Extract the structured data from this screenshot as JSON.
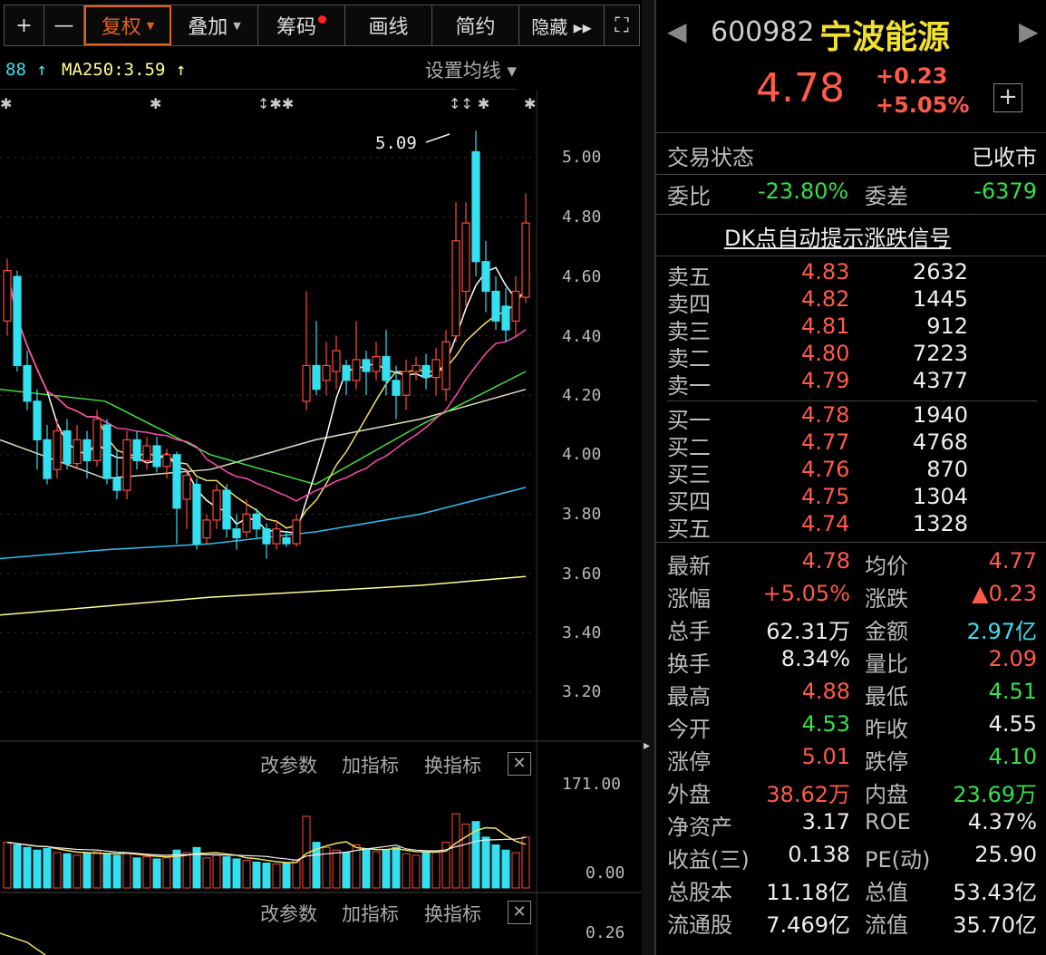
{
  "toolbar": {
    "plus": "+",
    "minus": "—",
    "fuquan": "复权",
    "diejia": "叠加",
    "chouma": "筹码",
    "huaxian": "画线",
    "jianyue": "简约",
    "yincang": "隐藏 ▸▸",
    "fullscreen": "⛶"
  },
  "legend": {
    "ma_prev": "88 ↑",
    "ma250": "MA250:3.59 ↑",
    "set_ma": "设置均线 ▾"
  },
  "peak_label": "5.09",
  "price_axis": [
    "5.00",
    "4.80",
    "4.60",
    "4.40",
    "4.20",
    "4.00",
    "3.80",
    "3.60",
    "3.40",
    "3.20"
  ],
  "volume_axis": [
    "171.00",
    "0.00"
  ],
  "indicator_axis": "0.26",
  "pane_buttons": {
    "params": "改参数",
    "add": "加指标",
    "swap": "换指标",
    "close": "✕"
  },
  "colors": {
    "up": "#ff4a3a",
    "down": "#33e0f0",
    "ma5": "#ffffff",
    "ma10": "#f0e060",
    "ma20": "#ff4ab0",
    "ma30": "#40e040",
    "ma60": "#e0e0c0",
    "ma120": "#30c0f0",
    "ma250": "#ffff90"
  },
  "chart_data": {
    "type": "candlestick",
    "ohlc": [
      [
        4.45,
        4.62,
        4.66,
        4.4
      ],
      [
        4.6,
        4.3,
        4.62,
        4.28
      ],
      [
        4.3,
        4.18,
        4.35,
        4.15
      ],
      [
        4.18,
        4.05,
        4.22,
        3.95
      ],
      [
        4.05,
        3.92,
        4.1,
        3.9
      ],
      [
        3.95,
        4.08,
        4.12,
        3.92
      ],
      [
        4.08,
        3.97,
        4.12,
        3.95
      ],
      [
        3.97,
        4.05,
        4.1,
        3.95
      ],
      [
        4.05,
        3.98,
        4.08,
        3.92
      ],
      [
        3.98,
        4.12,
        4.15,
        3.96
      ],
      [
        4.1,
        3.92,
        4.12,
        3.9
      ],
      [
        3.92,
        3.88,
        4.02,
        3.85
      ],
      [
        3.88,
        4.05,
        4.08,
        3.85
      ],
      [
        4.05,
        3.98,
        4.08,
        3.95
      ],
      [
        3.98,
        4.03,
        4.06,
        3.95
      ],
      [
        4.03,
        3.96,
        4.06,
        3.94
      ],
      [
        3.96,
        4.0,
        4.02,
        3.92
      ],
      [
        4.0,
        3.82,
        4.01,
        3.7
      ],
      [
        3.85,
        3.93,
        3.95,
        3.75
      ],
      [
        3.9,
        3.7,
        3.92,
        3.68
      ],
      [
        3.72,
        3.78,
        3.8,
        3.7
      ],
      [
        3.78,
        3.88,
        3.9,
        3.75
      ],
      [
        3.88,
        3.75,
        3.9,
        3.72
      ],
      [
        3.75,
        3.72,
        3.8,
        3.68
      ],
      [
        3.74,
        3.8,
        3.85,
        3.72
      ],
      [
        3.8,
        3.75,
        3.82,
        3.72
      ],
      [
        3.75,
        3.7,
        3.77,
        3.65
      ],
      [
        3.7,
        3.75,
        3.78,
        3.68
      ],
      [
        3.72,
        3.7,
        3.74,
        3.69
      ],
      [
        3.7,
        3.78,
        3.8,
        3.69
      ],
      [
        4.18,
        4.3,
        4.55,
        4.15
      ],
      [
        4.3,
        4.22,
        4.45,
        4.2
      ],
      [
        4.25,
        4.3,
        4.38,
        4.2
      ],
      [
        4.28,
        4.35,
        4.4,
        4.22
      ],
      [
        4.3,
        4.25,
        4.32,
        4.2
      ],
      [
        4.25,
        4.32,
        4.45,
        4.22
      ],
      [
        4.32,
        4.28,
        4.35,
        4.2
      ],
      [
        4.28,
        4.33,
        4.38,
        4.25
      ],
      [
        4.33,
        4.25,
        4.42,
        4.2
      ],
      [
        4.25,
        4.2,
        4.3,
        4.12
      ],
      [
        4.2,
        4.28,
        4.32,
        4.15
      ],
      [
        4.28,
        4.3,
        4.33,
        4.25
      ],
      [
        4.3,
        4.26,
        4.34,
        4.22
      ],
      [
        4.26,
        4.32,
        4.36,
        4.2
      ],
      [
        4.22,
        4.38,
        4.42,
        4.18
      ],
      [
        4.4,
        4.72,
        4.85,
        4.38
      ],
      [
        4.55,
        4.78,
        4.85,
        4.5
      ],
      [
        5.02,
        4.65,
        5.09,
        4.6
      ],
      [
        4.65,
        4.55,
        4.72,
        4.48
      ],
      [
        4.55,
        4.45,
        4.6,
        4.42
      ],
      [
        4.5,
        4.42,
        4.56,
        4.38
      ],
      [
        4.45,
        4.55,
        4.6,
        4.4
      ],
      [
        4.53,
        4.78,
        4.88,
        4.51
      ]
    ],
    "volume": [
      60,
      55,
      50,
      45,
      48,
      40,
      38,
      35,
      40,
      42,
      38,
      35,
      40,
      30,
      32,
      28,
      30,
      45,
      40,
      50,
      30,
      35,
      32,
      28,
      25,
      22,
      20,
      18,
      20,
      25,
      110,
      60,
      50,
      45,
      40,
      55,
      48,
      42,
      45,
      50,
      38,
      35,
      40,
      42,
      60,
      115,
      95,
      100,
      70,
      55,
      45,
      40,
      70
    ],
    "long_ma": {
      "ma60": [
        4.05,
        3.92,
        3.95,
        4.05,
        4.12,
        4.22
      ],
      "ma120": [
        3.65,
        3.68,
        3.7,
        3.74,
        3.8,
        3.89
      ],
      "ma250": [
        3.46,
        3.49,
        3.52,
        3.54,
        3.56,
        3.59
      ],
      "ma30": [
        4.22,
        4.18,
        4.0,
        3.9,
        4.1,
        4.28
      ]
    },
    "ylim": [
      3.1,
      5.15
    ]
  },
  "quote": {
    "code": "600982",
    "name": "宁波能源",
    "price": "4.78",
    "change": "+0.23",
    "pct": "+5.05%",
    "add": "+"
  },
  "status": {
    "label": "交易状态",
    "value": "已收市"
  },
  "weibi": {
    "label": "委比",
    "value": "-23.80%",
    "diff_label": "委差",
    "diff": "-6379"
  },
  "dk_link": "DK点自动提示涨跌信号",
  "asks": [
    {
      "label": "卖五",
      "price": "4.83",
      "vol": "2632"
    },
    {
      "label": "卖四",
      "price": "4.82",
      "vol": "1445"
    },
    {
      "label": "卖三",
      "price": "4.81",
      "vol": "912"
    },
    {
      "label": "卖二",
      "price": "4.80",
      "vol": "7223"
    },
    {
      "label": "卖一",
      "price": "4.79",
      "vol": "4377"
    }
  ],
  "bids": [
    {
      "label": "买一",
      "price": "4.78",
      "vol": "1940"
    },
    {
      "label": "买二",
      "price": "4.77",
      "vol": "4768"
    },
    {
      "label": "买三",
      "price": "4.76",
      "vol": "870"
    },
    {
      "label": "买四",
      "price": "4.75",
      "vol": "1304"
    },
    {
      "label": "买五",
      "price": "4.74",
      "vol": "1328"
    }
  ],
  "stats": [
    {
      "l1": "最新",
      "v1": "4.78",
      "c1": "red",
      "l2": "均价",
      "v2": "4.77",
      "c2": "red"
    },
    {
      "l1": "涨幅",
      "v1": "+5.05%",
      "c1": "red",
      "l2": "涨跌",
      "v2": "▲0.23",
      "c2": "red"
    },
    {
      "l1": "总手",
      "v1": "62.31万",
      "c1": "wht",
      "l2": "金额",
      "v2": "2.97亿",
      "c2": "cyn"
    },
    {
      "l1": "换手",
      "v1": "8.34%",
      "c1": "wht",
      "l2": "量比",
      "v2": "2.09",
      "c2": "red"
    },
    {
      "l1": "最高",
      "v1": "4.88",
      "c1": "red",
      "l2": "最低",
      "v2": "4.51",
      "c2": "grn"
    },
    {
      "l1": "今开",
      "v1": "4.53",
      "c1": "grn",
      "l2": "昨收",
      "v2": "4.55",
      "c2": "wht"
    },
    {
      "l1": "涨停",
      "v1": "5.01",
      "c1": "red",
      "l2": "跌停",
      "v2": "4.10",
      "c2": "grn"
    },
    {
      "l1": "外盘",
      "v1": "38.62万",
      "c1": "red",
      "l2": "内盘",
      "v2": "23.69万",
      "c2": "grn"
    },
    {
      "l1": "净资产",
      "v1": "3.17",
      "c1": "wht",
      "l2": "ROE",
      "v2": "4.37%",
      "c2": "wht"
    },
    {
      "l1": "收益(三)",
      "v1": "0.138",
      "c1": "wht",
      "l2": "PE(动)",
      "v2": "25.90",
      "c2": "wht"
    },
    {
      "l1": "总股本",
      "v1": "11.18亿",
      "c1": "wht",
      "l2": "总值",
      "v2": "53.43亿",
      "c2": "wht"
    },
    {
      "l1": "流通股",
      "v1": "7.469亿",
      "c1": "wht",
      "l2": "流值",
      "v2": "35.70亿",
      "c2": "wht"
    }
  ]
}
